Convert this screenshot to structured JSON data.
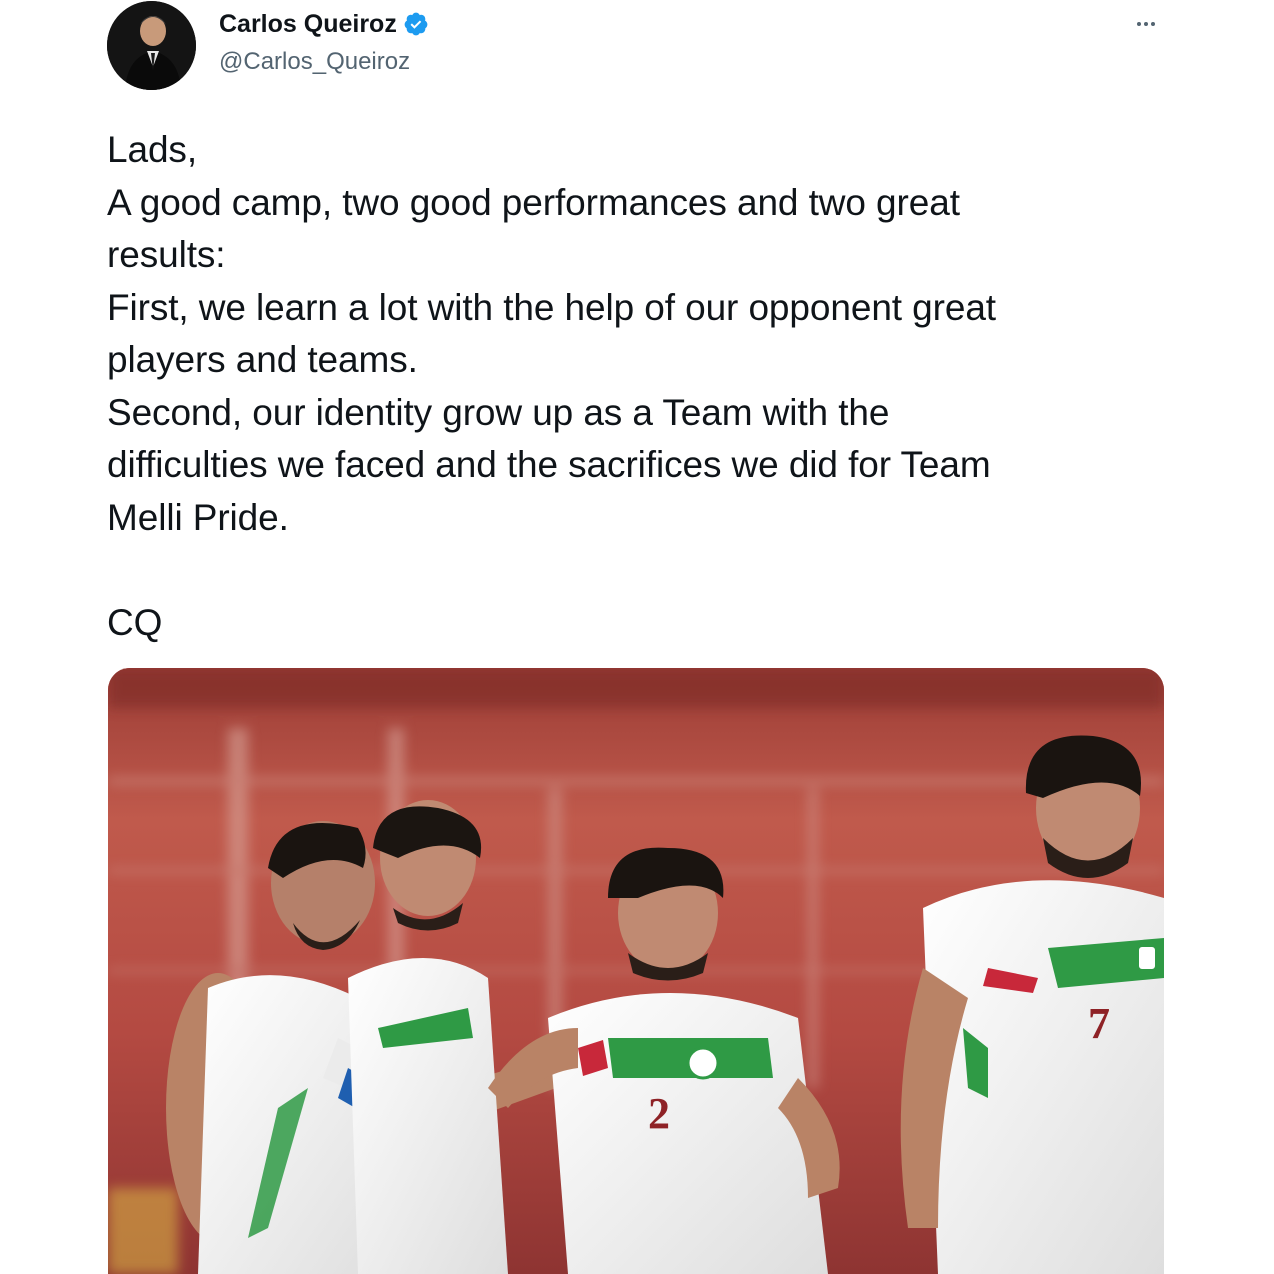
{
  "author": {
    "name": "Carlos Queiroz",
    "handle": "@Carlos_Queiroz",
    "verified_icon": "verified-badge-icon",
    "verified_color": "#1d9bf0"
  },
  "more_icon": "more-options-icon",
  "tweet": {
    "lines": [
      "Lads,",
      "A good camp, two good performances and two great",
      "results:",
      "First, we learn a lot with the help of our opponent great",
      "players and teams.",
      "Second, our identity grow up as a Team with the",
      "difficulties we faced and the sacrifices we did for Team",
      "Melli Pride.",
      "",
      "CQ"
    ]
  },
  "media": {
    "jersey_numbers": [
      "2",
      "7"
    ]
  },
  "colors": {
    "text": "#0f1419",
    "secondary": "#536471",
    "accent": "#1d9bf0",
    "jersey_green": "#2f9a45",
    "jersey_red": "#c8283a",
    "stadium_red": "#b85045"
  }
}
